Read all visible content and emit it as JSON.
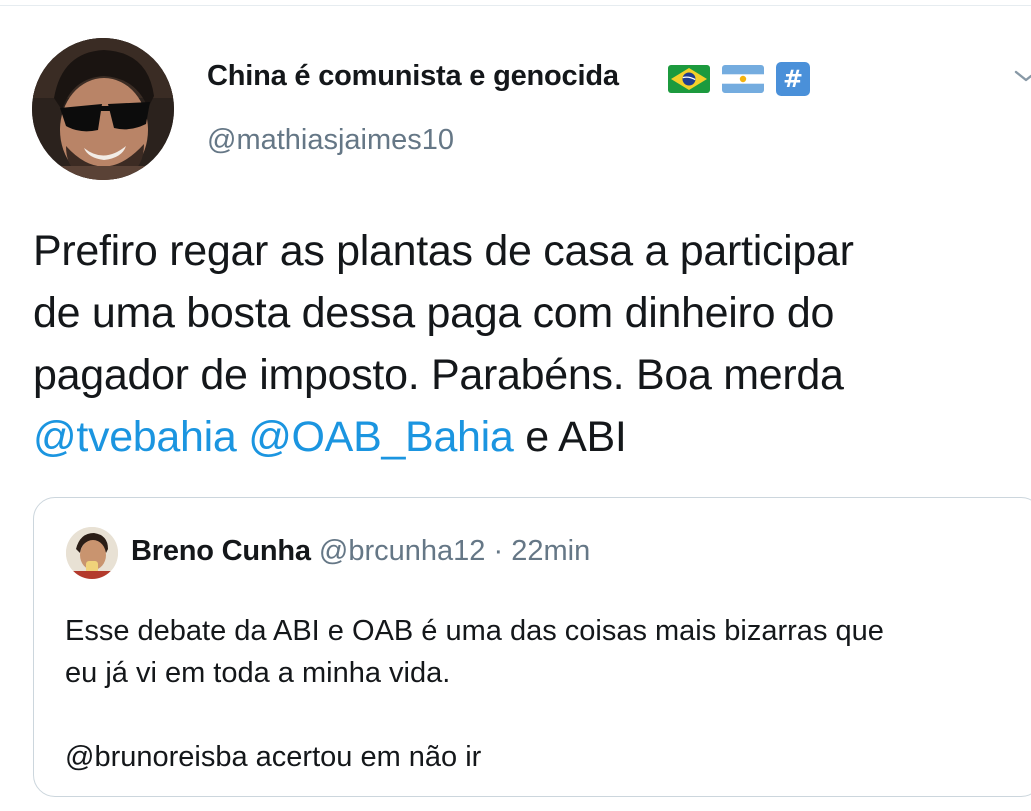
{
  "author": {
    "display_name": "China é comunista e genocida",
    "name_emojis": [
      "brazil-flag",
      "argentina-flag",
      "hashtag-keycap"
    ],
    "hashtag_glyph": "#",
    "handle": "@mathiasjaimes10"
  },
  "tweet": {
    "line1": "Prefiro regar as plantas de casa a participar",
    "line2": "de uma bosta dessa paga com dinheiro do",
    "line3": "pagador de imposto. Parabéns. Boa merda",
    "mention1": "@tvebahia",
    "mention2": "@OAB_Bahia",
    "line4_tail": "e ABI"
  },
  "quoted": {
    "display_name": "Breno Cunha",
    "handle": "@brcunha12",
    "separator": "·",
    "time": "22min",
    "line1": "Esse debate da ABI e OAB é uma das coisas mais bizarras que",
    "line2": "eu já vi em toda a minha vida.",
    "line3": "",
    "line4": "@brunoreisba acertou em não ir"
  },
  "colors": {
    "text": "#14171a",
    "secondary": "#657786",
    "link": "#1b95e0",
    "border": "#ccd6dd"
  },
  "icons": {
    "caret": "chevron-down-icon"
  }
}
